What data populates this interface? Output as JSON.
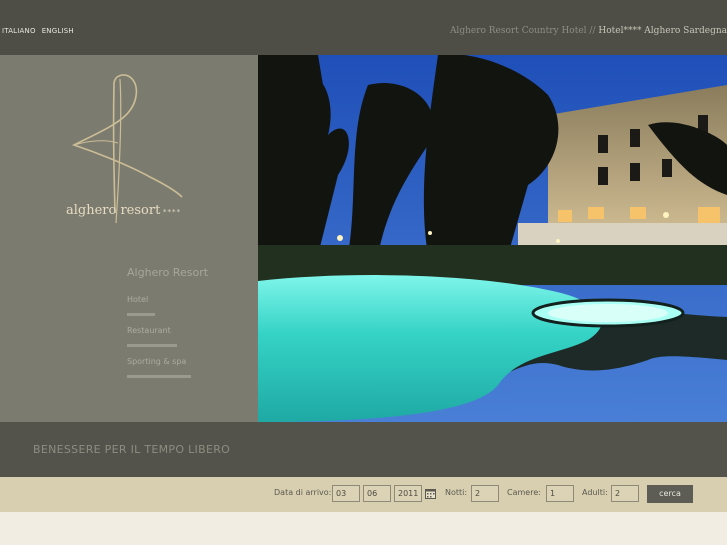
{
  "header": {
    "languages": [
      "ITALIANO",
      "ENGLISH"
    ],
    "tagline_prefix": "Alghero Resort Country Hotel //",
    "tagline_highlight": "Hotel**** Alghero Sardegna"
  },
  "logo": {
    "text": "alghero resort",
    "stars": "****"
  },
  "nav": {
    "title": "Alghero Resort",
    "items": [
      {
        "label": "Hotel"
      },
      {
        "label": "Restaurant"
      },
      {
        "label": "Sporting & spa"
      }
    ]
  },
  "banner": {
    "text": "BENESSERE PER IL TEMPO LIBERO"
  },
  "booking": {
    "arrival_label": "Data di arrivo:",
    "day": "03",
    "month": "06",
    "year": "2011",
    "nights_label": "Notti:",
    "nights": "2",
    "rooms_label": "Camere:",
    "rooms": "1",
    "adults_label": "Adulti:",
    "adults": "2",
    "search_label": "cerca"
  },
  "colors": {
    "header_bg": "#4e4d46",
    "panel_bg": "#7c7b70",
    "banner_bg": "#54534b",
    "booking_bg": "#d8cfb0",
    "pool": "#3fd8c8"
  }
}
